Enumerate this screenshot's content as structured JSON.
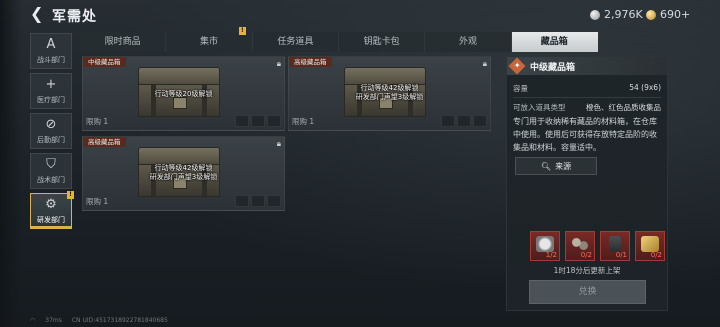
{
  "header": {
    "back_icon": "back-arrow-icon",
    "title": "军需处",
    "currency_silver": "2,976K",
    "currency_gold": "690+"
  },
  "leftnav": [
    {
      "label": "战斗部门",
      "icon": "A",
      "icon_name": "combat-icon"
    },
    {
      "label": "医疗部门",
      "icon": "+",
      "icon_name": "medical-icon"
    },
    {
      "label": "后勤部门",
      "icon": "⊘",
      "icon_name": "logistics-icon"
    },
    {
      "label": "战术部门",
      "icon": "⛉",
      "icon_name": "tactics-icon"
    },
    {
      "label": "研发部门",
      "icon": "⚙",
      "icon_name": "research-icon",
      "active": true,
      "badge": "!"
    }
  ],
  "tabs": [
    {
      "label": "限时商品"
    },
    {
      "label": "集市",
      "badge": "!"
    },
    {
      "label": "任务道具"
    },
    {
      "label": "钥匙卡包"
    },
    {
      "label": "外观"
    },
    {
      "label": "藏品箱",
      "active": true
    }
  ],
  "cards": [
    {
      "rarity": "中级藏品箱",
      "unlock": "行动等级20级解锁",
      "owned": "限购 1",
      "rarity_color": "#5b2a1f"
    },
    {
      "rarity": "高级藏品箱",
      "unlock": "行动等级42级解锁\n研发部门声望3级解锁",
      "owned": "限购 1",
      "rarity_color": "#5b2a1f"
    },
    {
      "rarity": "高级藏品箱",
      "unlock": "行动等级42级解锁\n研发部门声望3级解锁",
      "owned": "限购 1",
      "rarity_color": "#5b2a1f"
    }
  ],
  "detail": {
    "title": "中级藏品箱",
    "capacity_label": "容量",
    "capacity_value": "54 (9x6)",
    "types_label": "可放入道具类型",
    "types_value": "橙色、红色品质收集品",
    "description": "专门用于收纳稀有藏品的材料箱，在仓库中使用。使用后可获得存放特定品阶的收集品和材料。容量适中。",
    "source_label": "来源",
    "materials": [
      {
        "count": "1/2",
        "icon": "pocket-watch-icon"
      },
      {
        "count": "0/2",
        "icon": "gears-icon"
      },
      {
        "count": "0/1",
        "icon": "device-icon"
      },
      {
        "count": "0/2",
        "icon": "gold-bars-icon"
      }
    ],
    "refresh_text": "1时18分后更新上架",
    "exchange_label": "兑换"
  },
  "footer": {
    "ping": "37ms",
    "uid": "CN UID:4517318922781840685"
  }
}
